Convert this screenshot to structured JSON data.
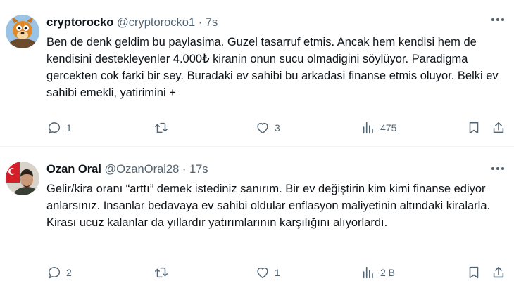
{
  "tweets": [
    {
      "name": "cryptorocko",
      "handle": "@cryptorocko1",
      "separator": "·",
      "time": "7s",
      "text": "Ben de denk geldim bu paylasima. Guzel tasarruf etmis. Ancak hem kendisi hem de kendisini destekleyenler 4.000₺ kiranin onun sucu olmadigini söylüyor. Paradigma gercekten cok farki bir sey. Buradaki ev sahibi bu arkadasi finanse etmis oluyor. Belki ev sahibi emekli, yatirimini +",
      "reply_count": "1",
      "retweet_count": "",
      "like_count": "3",
      "view_count": "475",
      "avatar_icon": "cartoon-character-avatar"
    },
    {
      "name": "Ozan Oral",
      "handle": "@OzanOral28",
      "separator": "·",
      "time": "17s",
      "text": "Gelir/kira oranı “arttı” demek istediniz sanırım. Bir ev değiştirin kim kimi finanse ediyor anlarsınız. Insanlar bedavaya ev sahibi oldular enflasyon maliyetinin altındaki kiralarla. Kirası ucuz kalanlar da yıllardır yatırımlarının karşılığını alıyorlardı.",
      "reply_count": "2",
      "retweet_count": "",
      "like_count": "1",
      "view_count": "2 B",
      "avatar_icon": "profile-photo-avatar"
    }
  ],
  "colors": {
    "text": "#0f1419",
    "secondary": "#536471",
    "divider": "#eff3f4"
  }
}
